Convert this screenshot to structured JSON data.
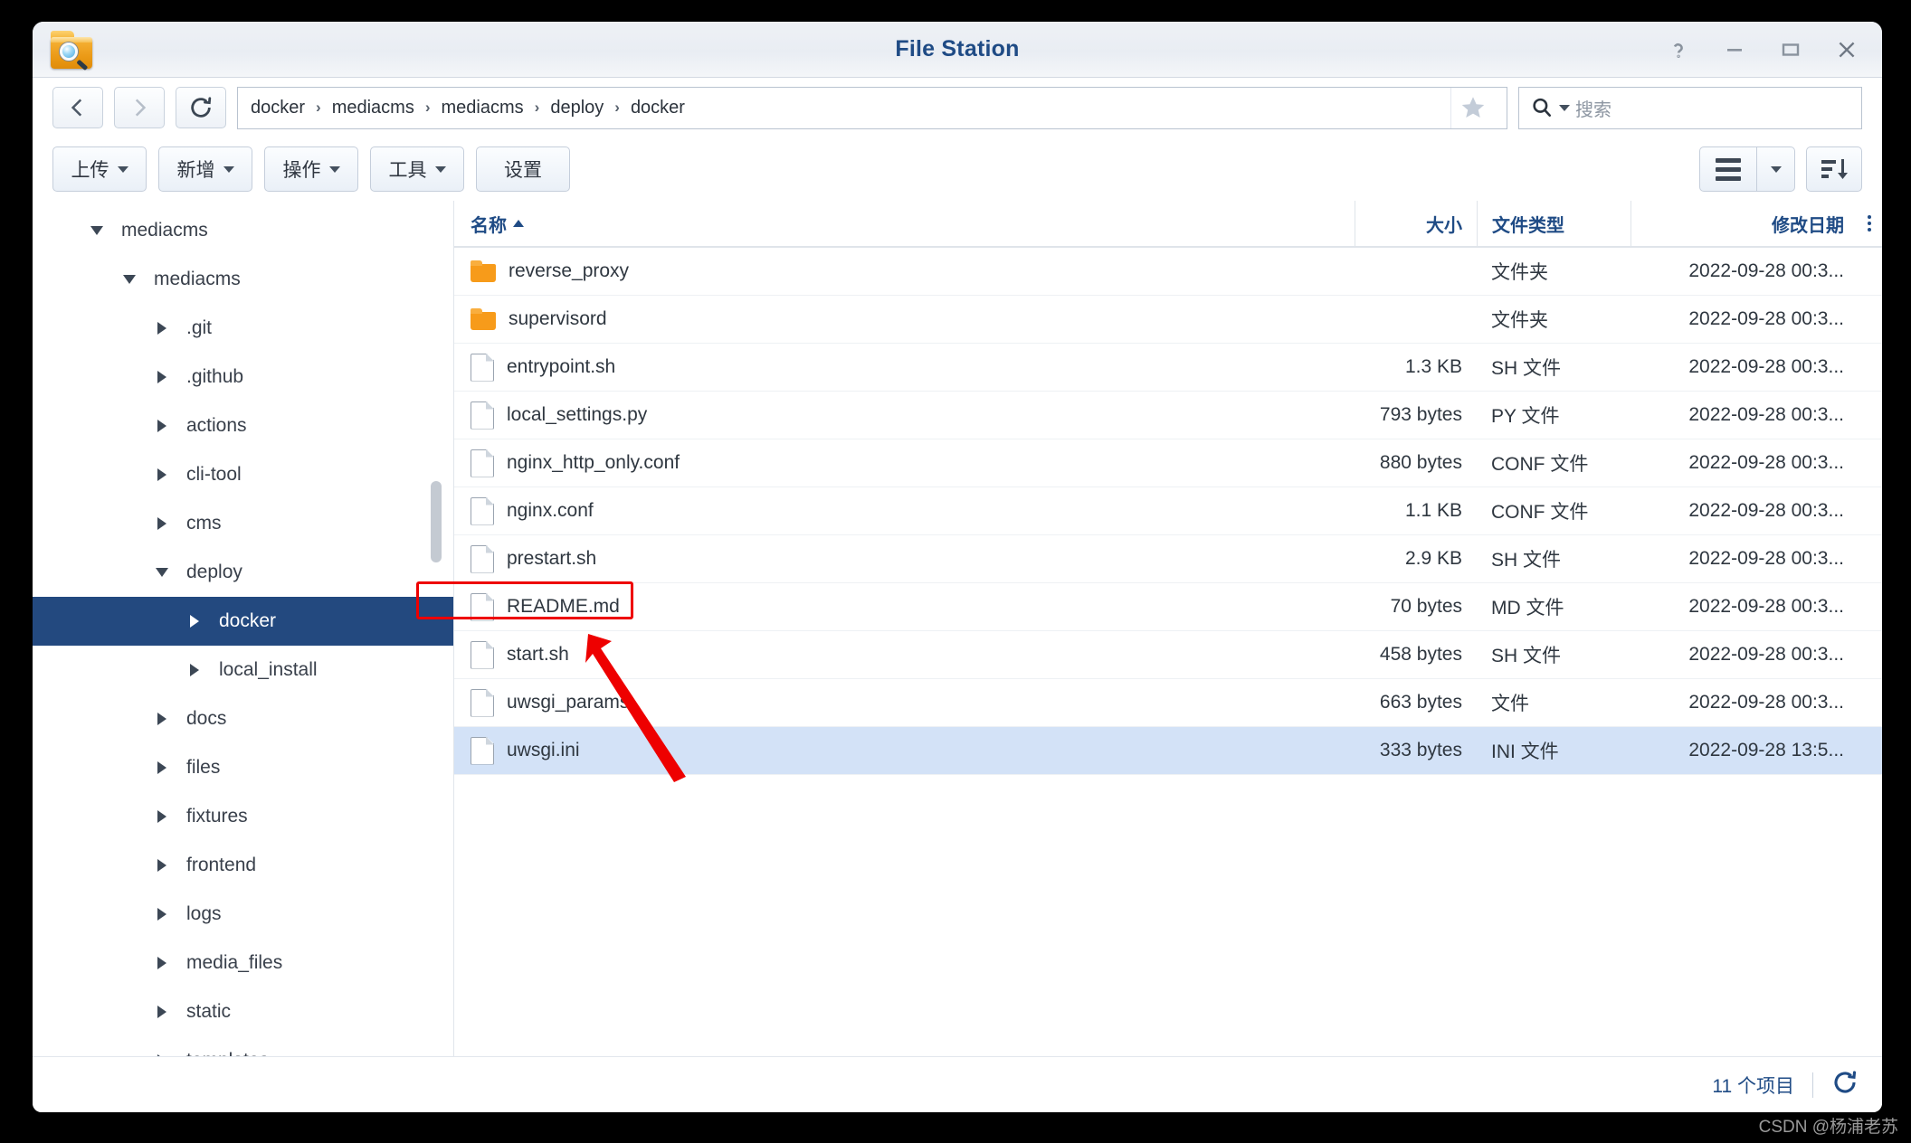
{
  "window": {
    "title": "File Station",
    "app_icon": "folder-search-icon",
    "controls": [
      {
        "name": "help",
        "icon": "question-mark-icon"
      },
      {
        "name": "minimize",
        "icon": "minimize-icon"
      },
      {
        "name": "maximize",
        "icon": "maximize-icon"
      },
      {
        "name": "close",
        "icon": "close-icon"
      }
    ]
  },
  "pathbar": {
    "back_icon": "chevron-left-icon",
    "forward_icon": "chevron-right-icon",
    "refresh_icon": "refresh-icon",
    "breadcrumbs": [
      "docker",
      "mediacms",
      "mediacms",
      "deploy",
      "docker"
    ],
    "separator": "›",
    "favorite_icon": "star-icon",
    "search": {
      "icon": "search-icon",
      "placeholder": "搜索",
      "value": ""
    }
  },
  "toolbar": {
    "buttons": [
      {
        "label": "上传",
        "has_caret": true
      },
      {
        "label": "新增",
        "has_caret": true
      },
      {
        "label": "操作",
        "has_caret": true
      },
      {
        "label": "工具",
        "has_caret": true
      },
      {
        "label": "设置",
        "has_caret": false
      }
    ],
    "view_icon": "list-view-icon",
    "view_caret_icon": "chevron-down-icon",
    "sort_icon": "sort-descending-icon"
  },
  "sidebar": {
    "items": [
      {
        "label": "mediacms",
        "depth": 0,
        "state": "expanded",
        "selected": false
      },
      {
        "label": "mediacms",
        "depth": 1,
        "state": "expanded",
        "selected": false
      },
      {
        "label": ".git",
        "depth": 2,
        "state": "collapsed",
        "selected": false
      },
      {
        "label": ".github",
        "depth": 2,
        "state": "collapsed",
        "selected": false
      },
      {
        "label": "actions",
        "depth": 2,
        "state": "collapsed",
        "selected": false
      },
      {
        "label": "cli-tool",
        "depth": 2,
        "state": "collapsed",
        "selected": false
      },
      {
        "label": "cms",
        "depth": 2,
        "state": "collapsed",
        "selected": false
      },
      {
        "label": "deploy",
        "depth": 2,
        "state": "expanded",
        "selected": false
      },
      {
        "label": "docker",
        "depth": 3,
        "state": "collapsed",
        "selected": true
      },
      {
        "label": "local_install",
        "depth": 3,
        "state": "collapsed",
        "selected": false
      },
      {
        "label": "docs",
        "depth": 2,
        "state": "collapsed",
        "selected": false
      },
      {
        "label": "files",
        "depth": 2,
        "state": "collapsed",
        "selected": false
      },
      {
        "label": "fixtures",
        "depth": 2,
        "state": "collapsed",
        "selected": false
      },
      {
        "label": "frontend",
        "depth": 2,
        "state": "collapsed",
        "selected": false
      },
      {
        "label": "logs",
        "depth": 2,
        "state": "collapsed",
        "selected": false
      },
      {
        "label": "media_files",
        "depth": 2,
        "state": "collapsed",
        "selected": false
      },
      {
        "label": "static",
        "depth": 2,
        "state": "collapsed",
        "selected": false
      },
      {
        "label": "templates",
        "depth": 2,
        "state": "collapsed",
        "selected": false
      }
    ]
  },
  "filelist": {
    "columns": {
      "name": "名称",
      "size": "大小",
      "type": "文件类型",
      "date": "修改日期"
    },
    "sort_column": "name",
    "sort_direction": "asc",
    "rows": [
      {
        "name": "reverse_proxy",
        "icon": "folder-icon",
        "size": "",
        "type": "文件夹",
        "date": "2022-09-28 00:3...",
        "selected": false
      },
      {
        "name": "supervisord",
        "icon": "folder-icon",
        "size": "",
        "type": "文件夹",
        "date": "2022-09-28 00:3...",
        "selected": false
      },
      {
        "name": "entrypoint.sh",
        "icon": "file-icon",
        "size": "1.3 KB",
        "type": "SH 文件",
        "date": "2022-09-28 00:3...",
        "selected": false
      },
      {
        "name": "local_settings.py",
        "icon": "file-icon",
        "size": "793 bytes",
        "type": "PY 文件",
        "date": "2022-09-28 00:3...",
        "selected": false
      },
      {
        "name": "nginx_http_only.conf",
        "icon": "file-icon",
        "size": "880 bytes",
        "type": "CONF 文件",
        "date": "2022-09-28 00:3...",
        "selected": false
      },
      {
        "name": "nginx.conf",
        "icon": "file-icon",
        "size": "1.1 KB",
        "type": "CONF 文件",
        "date": "2022-09-28 00:3...",
        "selected": false
      },
      {
        "name": "prestart.sh",
        "icon": "file-icon",
        "size": "2.9 KB",
        "type": "SH 文件",
        "date": "2022-09-28 00:3...",
        "selected": false
      },
      {
        "name": "README.md",
        "icon": "file-icon",
        "size": "70 bytes",
        "type": "MD 文件",
        "date": "2022-09-28 00:3...",
        "selected": false
      },
      {
        "name": "start.sh",
        "icon": "file-icon",
        "size": "458 bytes",
        "type": "SH 文件",
        "date": "2022-09-28 00:3...",
        "selected": false
      },
      {
        "name": "uwsgi_params",
        "icon": "file-icon",
        "size": "663 bytes",
        "type": "文件",
        "date": "2022-09-28 00:3...",
        "selected": false
      },
      {
        "name": "uwsgi.ini",
        "icon": "file-icon",
        "size": "333 bytes",
        "type": "INI 文件",
        "date": "2022-09-28 13:5...",
        "selected": true
      }
    ]
  },
  "footer": {
    "count_label": "11 个项目",
    "refresh_icon": "refresh-icon"
  },
  "annotations": {
    "highlight_color": "#ee0000",
    "target_row": "uwsgi.ini"
  },
  "watermark": "CSDN @杨浦老苏",
  "colors": {
    "title_blue": "#1f4b85",
    "selection_tree": "#23497f",
    "selection_row": "#d3e2f7",
    "folder_orange": "#f79b1a",
    "annotation_red": "#ee0000"
  }
}
